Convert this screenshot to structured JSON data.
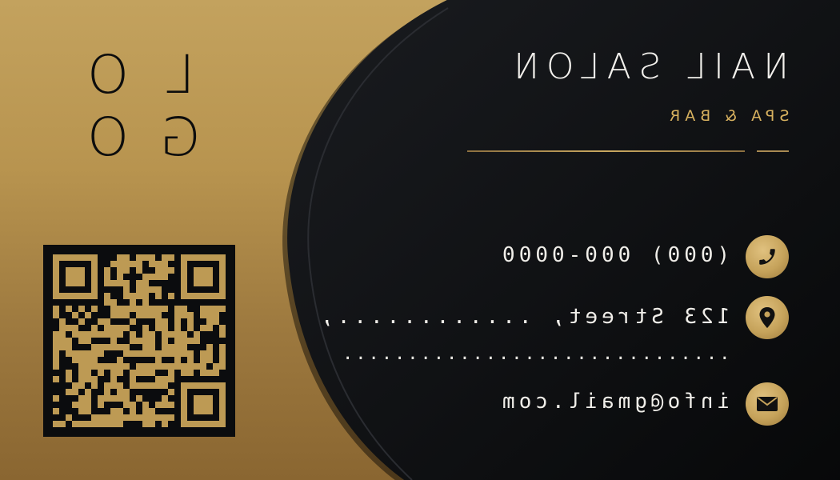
{
  "logo": {
    "line1": [
      "L",
      "O"
    ],
    "line2": [
      "G",
      "O"
    ]
  },
  "title": "NAIL SALON",
  "subtitle": "SPA & BAR",
  "contact": {
    "phone": "(000) 000-0000",
    "address": "123 Street, ............,",
    "address_line2": "..............................",
    "email": "info@gmail.com"
  },
  "icons": {
    "phone": "phone-icon",
    "address": "map-pin-icon",
    "email": "envelope-icon"
  },
  "colors": {
    "gold": "#c6a35b",
    "dark": "#0b0c0e",
    "text": "#f0eee9",
    "subtitle": "#d7b15f"
  }
}
